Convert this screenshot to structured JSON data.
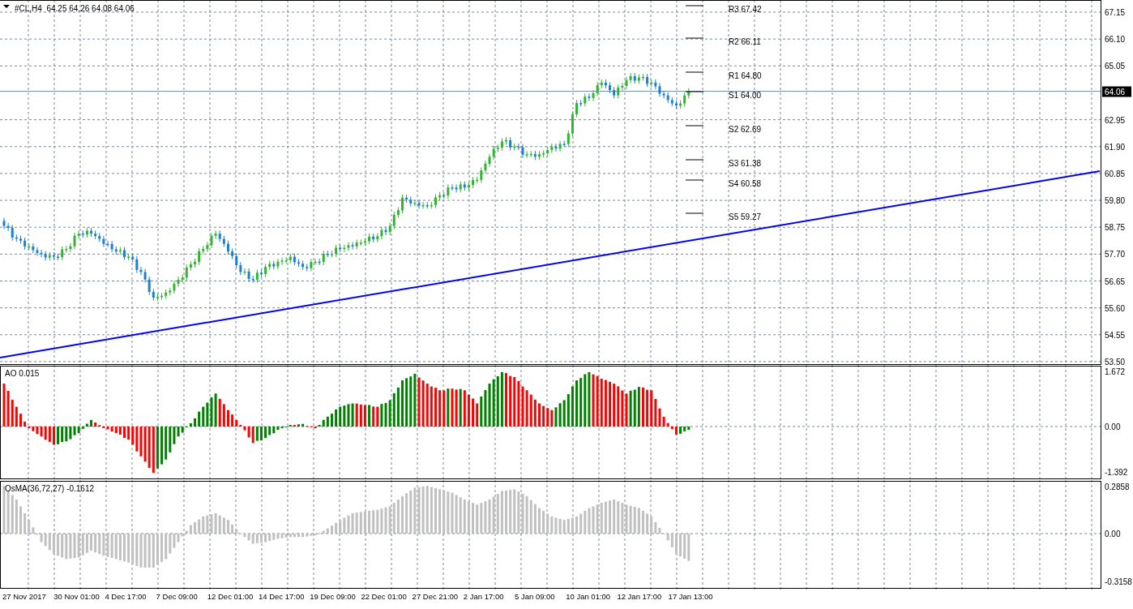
{
  "chart_window": {
    "title": "#CL,H4  64.25 64.26 64.08 64.06",
    "price_axis": [
      "67.15",
      "66.10",
      "65.05",
      "62.95",
      "61.90",
      "60.85",
      "59.80",
      "58.75",
      "57.70",
      "56.65",
      "55.60",
      "54.55",
      "53.50"
    ],
    "price_tag": "64.06",
    "pivot_levels": [
      "R3 67.42",
      "R2 66.11",
      "R1 64.80",
      "S1 64.00",
      "S2 62.69",
      "S3 61.38",
      "S4 60.58",
      "S5 59.27"
    ],
    "ao_panel": {
      "title": "AO 0.015",
      "axis": [
        "1.672",
        "0.00",
        "-1.392"
      ]
    },
    "osma_panel": {
      "title": "OsMA(36,72,27) -0.1612",
      "axis": [
        "0.2858",
        "0.00",
        "-0.3158"
      ]
    },
    "time_axis": [
      "27 Nov 2017",
      "30 Nov 01:00",
      "4 Dec 17:00",
      "7 Dec 09:00",
      "12 Dec 01:00",
      "14 Dec 17:00",
      "19 Dec 09:00",
      "22 Dec 01:00",
      "27 Dec 21:00",
      "2 Jan 17:00",
      "5 Jan 09:00",
      "10 Jan 01:00",
      "12 Jan 17:00",
      "17 Jan 13:00"
    ]
  }
}
